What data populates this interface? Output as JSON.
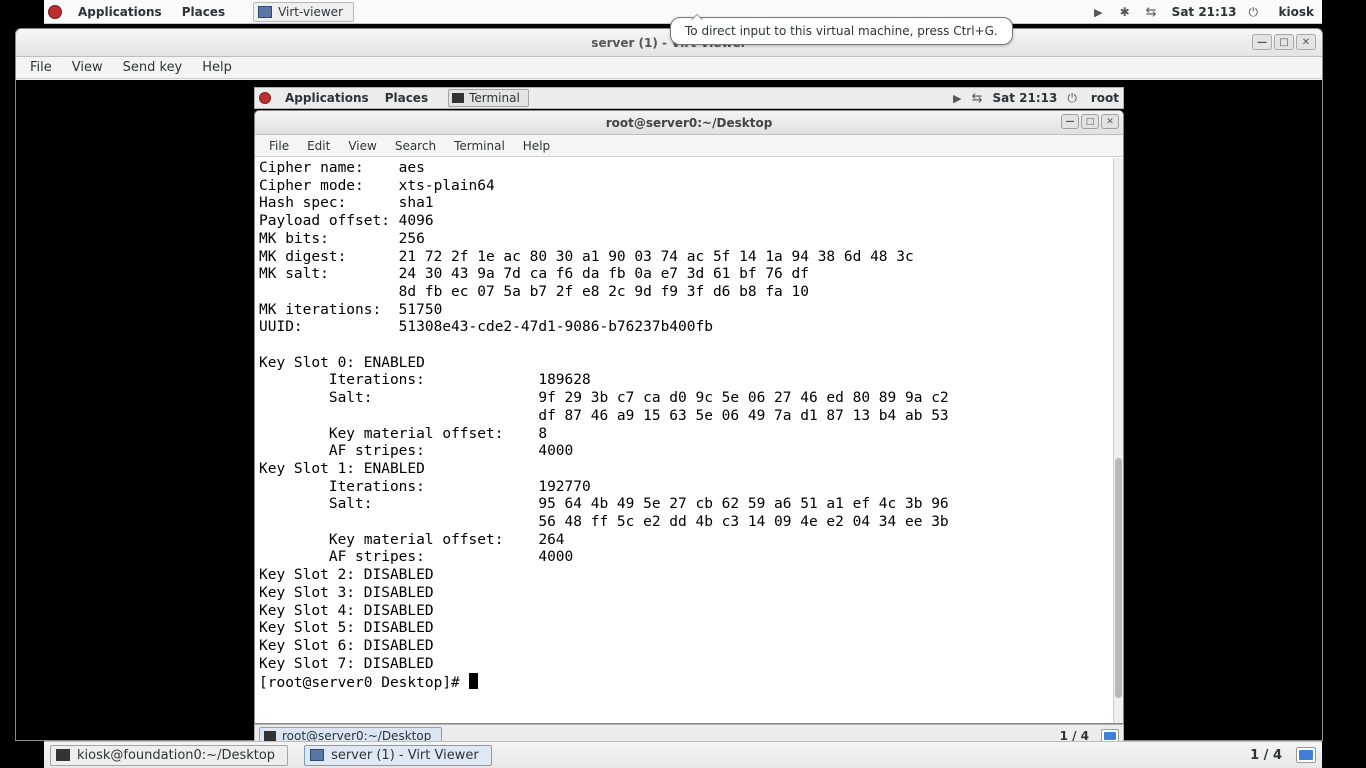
{
  "host_panel": {
    "applications": "Applications",
    "places": "Places",
    "task_label": "Virt-viewer",
    "clock": "Sat 21:13",
    "user": "kiosk"
  },
  "tooltip": "To direct input to this virtual machine, press Ctrl+G.",
  "virt_viewer": {
    "title": "server (1) - Virt Viewer",
    "menu": {
      "file": "File",
      "view": "View",
      "sendkey": "Send key",
      "help": "Help"
    }
  },
  "guest_panel": {
    "applications": "Applications",
    "places": "Places",
    "task_label": "Terminal",
    "clock": "Sat 21:13",
    "user": "root"
  },
  "terminal": {
    "title": "root@server0:~/Desktop",
    "menu": {
      "file": "File",
      "edit": "Edit",
      "view": "View",
      "search": "Search",
      "terminal": "Terminal",
      "help": "Help"
    },
    "lines": [
      "Cipher name:    aes",
      "Cipher mode:    xts-plain64",
      "Hash spec:      sha1",
      "Payload offset: 4096",
      "MK bits:        256",
      "MK digest:      21 72 2f 1e ac 80 30 a1 90 03 74 ac 5f 14 1a 94 38 6d 48 3c ",
      "MK salt:        24 30 43 9a 7d ca f6 da fb 0a e7 3d 61 bf 76 df ",
      "                8d fb ec 07 5a b7 2f e8 2c 9d f9 3f d6 b8 fa 10 ",
      "MK iterations:  51750",
      "UUID:           51308e43-cde2-47d1-9086-b76237b400fb",
      "",
      "Key Slot 0: ENABLED",
      "        Iterations:             189628",
      "        Salt:                   9f 29 3b c7 ca d0 9c 5e 06 27 46 ed 80 89 9a c2 ",
      "                                df 87 46 a9 15 63 5e 06 49 7a d1 87 13 b4 ab 53 ",
      "        Key material offset:    8",
      "        AF stripes:             4000",
      "Key Slot 1: ENABLED",
      "        Iterations:             192770",
      "        Salt:                   95 64 4b 49 5e 27 cb 62 59 a6 51 a1 ef 4c 3b 96 ",
      "                                56 48 ff 5c e2 dd 4b c3 14 09 4e e2 04 34 ee 3b ",
      "        Key material offset:    264",
      "        AF stripes:             4000",
      "Key Slot 2: DISABLED",
      "Key Slot 3: DISABLED",
      "Key Slot 4: DISABLED",
      "Key Slot 5: DISABLED",
      "Key Slot 6: DISABLED",
      "Key Slot 7: DISABLED"
    ],
    "prompt": "[root@server0 Desktop]# "
  },
  "guest_bottom": {
    "task_label": "root@server0:~/Desktop",
    "workspace": "1 / 4"
  },
  "host_bottom": {
    "task1": "kiosk@foundation0:~/Desktop",
    "task2": "server (1) - Virt Viewer",
    "workspace": "1 / 4"
  }
}
